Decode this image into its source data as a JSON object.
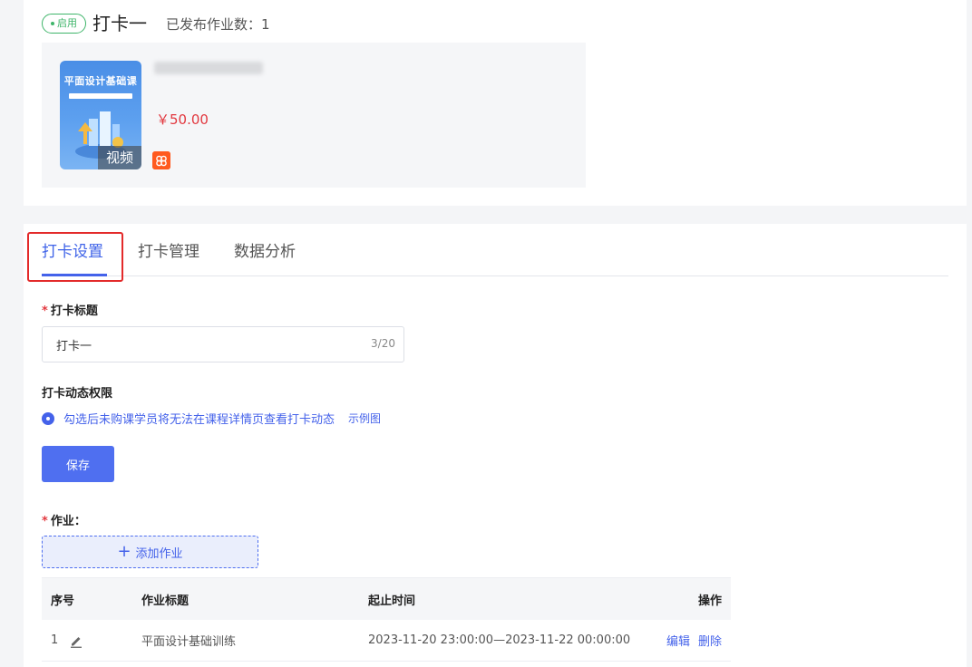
{
  "header": {
    "status_badge": "启用",
    "title": "打卡一",
    "published_label": "已发布作业数：1"
  },
  "course": {
    "thumbnail_title": "平面设计基础课",
    "thumbnail_tag": "视频",
    "price": "￥50.00",
    "thumb_colors": [
      "#4a8ee6",
      "#7bb4f3"
    ],
    "platform_icon": "store-icon"
  },
  "tabs": [
    {
      "label": "打卡设置",
      "active": true
    },
    {
      "label": "打卡管理",
      "active": false
    },
    {
      "label": "数据分析",
      "active": false
    }
  ],
  "form": {
    "title_label": "打卡标题",
    "title_value": "打卡一",
    "title_count": "3/20",
    "permission_label": "打卡动态权限",
    "permission_option": "勾选后未购课学员将无法在课程详情页查看打卡动态",
    "permission_checked": true,
    "example_link": "示例图",
    "save_label": "保存",
    "tasks_label": "作业：",
    "add_task_label": "添加作业"
  },
  "table": {
    "headers": [
      "序号",
      "作业标题",
      "起止时间",
      "操作"
    ],
    "rows": [
      {
        "index": "1",
        "title": "平面设计基础训练",
        "time": "2023-11-20 23:00:00—2023-11-22 00:00:00",
        "edit": "编辑",
        "delete": "删除"
      }
    ]
  },
  "colors": {
    "accent": "#4462ea",
    "enabled": "#3fb56a",
    "price": "#e2383f",
    "highlight": "#e32a2a"
  }
}
